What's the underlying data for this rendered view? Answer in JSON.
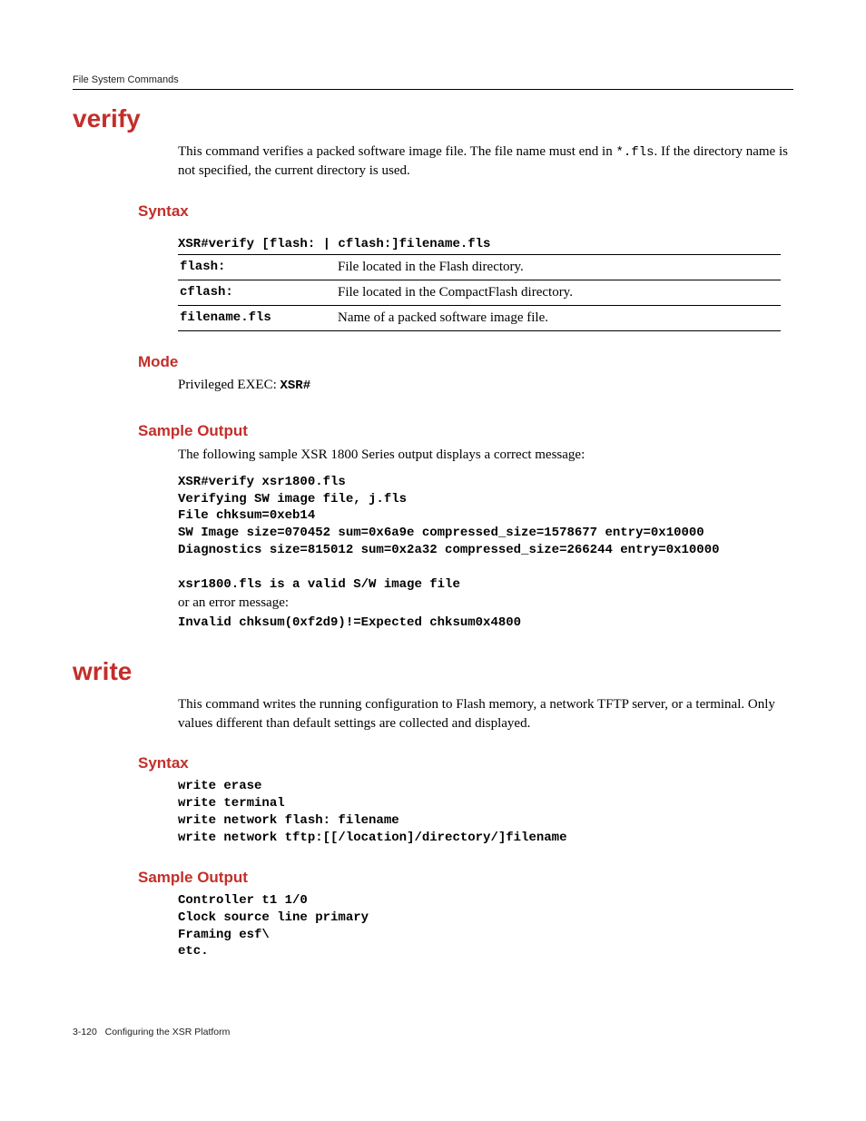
{
  "header": {
    "title": "File System Commands"
  },
  "footer": {
    "page": "3-120",
    "chapter": "Configuring the XSR Platform"
  },
  "verify": {
    "title": "verify",
    "intro_pre": "This command verifies a packed software image file. The file name must end in ",
    "intro_code": "*.fls",
    "intro_post": ". If the directory name is not specified, the current directory is used.",
    "syntax": {
      "heading": "Syntax",
      "cmd": "XSR#verify [flash: | cflash:]filename.fls",
      "rows": [
        {
          "k": "flash:",
          "v": "File located in the Flash directory."
        },
        {
          "k": "cflash:",
          "v": "File located in the CompactFlash directory."
        },
        {
          "k": "filename.fls",
          "v": "Name of a packed software image file."
        }
      ]
    },
    "mode": {
      "heading": "Mode",
      "text": "Privileged EXEC: ",
      "code": "XSR#"
    },
    "sample": {
      "heading": "Sample Output",
      "intro": "The following sample XSR 1800 Series output displays a correct message:",
      "block1": "XSR#verify xsr1800.fls\nVerifying SW image file, j.fls\nFile chksum=0xeb14\nSW Image size=070452 sum=0x6a9e compressed_size=1578677 entry=0x10000\nDiagnostics size=815012 sum=0x2a32 compressed_size=266244 entry=0x10000\n\nxsr1800.fls is a valid S/W image file",
      "err_intro": "or an error message:",
      "block2": "Invalid chksum(0xf2d9)!=Expected chksum0x4800"
    }
  },
  "write": {
    "title": "write",
    "intro": "This command writes the running configuration to Flash memory, a network TFTP server, or a terminal. Only values different than default settings are collected and displayed.",
    "syntax": {
      "heading": "Syntax",
      "block": "write erase\nwrite terminal\nwrite network flash: filename\nwrite network tftp:[[/location]/directory/]filename"
    },
    "sample": {
      "heading": "Sample Output",
      "block": "Controller t1 1/0\nClock source line primary\nFraming esf\\\netc."
    }
  }
}
